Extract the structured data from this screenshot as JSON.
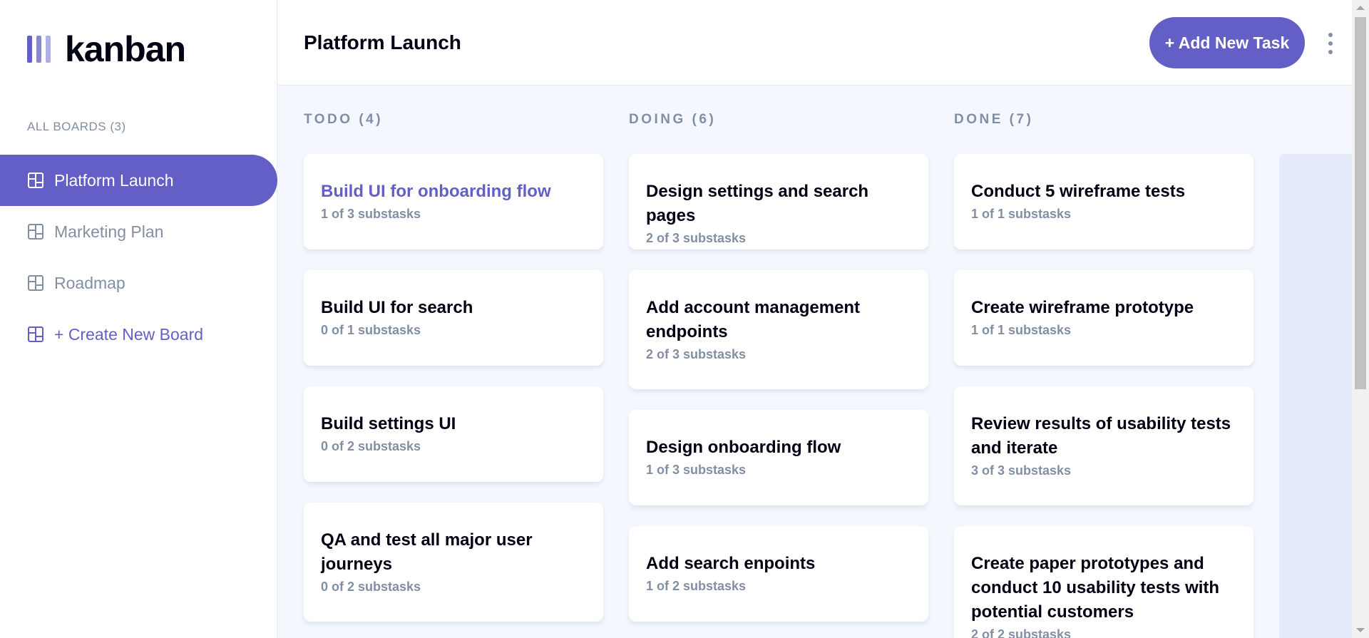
{
  "app": {
    "logo_text": "kanban"
  },
  "sidebar": {
    "heading": "ALL BOARDS (3)",
    "items": [
      {
        "label": "Platform Launch"
      },
      {
        "label": "Marketing Plan"
      },
      {
        "label": "Roadmap"
      }
    ],
    "create_label": "+ Create New Board"
  },
  "header": {
    "title": "Platform Launch",
    "add_task_label": "+ Add New Task"
  },
  "columns": [
    {
      "heading": "TODO (4)",
      "dot_color": "#49c4e5",
      "tasks": [
        {
          "title": "Build UI for onboarding flow",
          "subtasks": "1 of 3 substasks"
        },
        {
          "title": "Build UI for search",
          "subtasks": "0 of 1 substasks"
        },
        {
          "title": "Build settings UI",
          "subtasks": "0 of 2 substasks"
        },
        {
          "title": "QA and test all major user journeys",
          "subtasks": "0 of 2 substasks"
        }
      ]
    },
    {
      "heading": "DOING (6)",
      "dot_color": "#8471f2",
      "tasks": [
        {
          "title": "Design settings and search pages",
          "subtasks": "2 of 3 substasks"
        },
        {
          "title": "Add account management endpoints",
          "subtasks": "2 of 3 substasks"
        },
        {
          "title": "Design onboarding flow",
          "subtasks": "1 of 3 substasks"
        },
        {
          "title": "Add search enpoints",
          "subtasks": "1 of 2 substasks"
        }
      ]
    },
    {
      "heading": "DONE (7)",
      "dot_color": "#67e2ae",
      "tasks": [
        {
          "title": "Conduct 5 wireframe tests",
          "subtasks": "1 of 1 substasks"
        },
        {
          "title": "Create wireframe prototype",
          "subtasks": "1 of 1 substasks"
        },
        {
          "title": "Review results of usability tests and iterate",
          "subtasks": "3 of 3 substasks"
        },
        {
          "title": "Create paper prototypes and conduct 10 usability tests with potential customers",
          "subtasks": "2 of 2 substasks"
        }
      ]
    }
  ],
  "colors": {
    "accent": "#635fc7",
    "text_primary": "#000112",
    "text_secondary": "#828fa3",
    "board_bg": "#f4f7fd"
  }
}
